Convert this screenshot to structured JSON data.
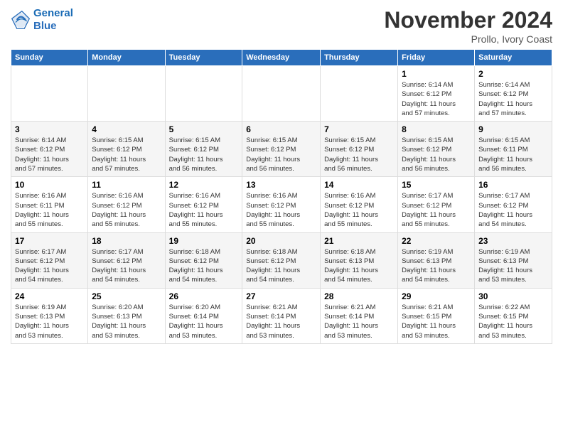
{
  "header": {
    "logo_line1": "General",
    "logo_line2": "Blue",
    "month_title": "November 2024",
    "subtitle": "Prollo, Ivory Coast"
  },
  "days_of_week": [
    "Sunday",
    "Monday",
    "Tuesday",
    "Wednesday",
    "Thursday",
    "Friday",
    "Saturday"
  ],
  "weeks": [
    [
      {
        "day": "",
        "info": ""
      },
      {
        "day": "",
        "info": ""
      },
      {
        "day": "",
        "info": ""
      },
      {
        "day": "",
        "info": ""
      },
      {
        "day": "",
        "info": ""
      },
      {
        "day": "1",
        "info": "Sunrise: 6:14 AM\nSunset: 6:12 PM\nDaylight: 11 hours\nand 57 minutes."
      },
      {
        "day": "2",
        "info": "Sunrise: 6:14 AM\nSunset: 6:12 PM\nDaylight: 11 hours\nand 57 minutes."
      }
    ],
    [
      {
        "day": "3",
        "info": "Sunrise: 6:14 AM\nSunset: 6:12 PM\nDaylight: 11 hours\nand 57 minutes."
      },
      {
        "day": "4",
        "info": "Sunrise: 6:15 AM\nSunset: 6:12 PM\nDaylight: 11 hours\nand 57 minutes."
      },
      {
        "day": "5",
        "info": "Sunrise: 6:15 AM\nSunset: 6:12 PM\nDaylight: 11 hours\nand 56 minutes."
      },
      {
        "day": "6",
        "info": "Sunrise: 6:15 AM\nSunset: 6:12 PM\nDaylight: 11 hours\nand 56 minutes."
      },
      {
        "day": "7",
        "info": "Sunrise: 6:15 AM\nSunset: 6:12 PM\nDaylight: 11 hours\nand 56 minutes."
      },
      {
        "day": "8",
        "info": "Sunrise: 6:15 AM\nSunset: 6:12 PM\nDaylight: 11 hours\nand 56 minutes."
      },
      {
        "day": "9",
        "info": "Sunrise: 6:15 AM\nSunset: 6:11 PM\nDaylight: 11 hours\nand 56 minutes."
      }
    ],
    [
      {
        "day": "10",
        "info": "Sunrise: 6:16 AM\nSunset: 6:11 PM\nDaylight: 11 hours\nand 55 minutes."
      },
      {
        "day": "11",
        "info": "Sunrise: 6:16 AM\nSunset: 6:12 PM\nDaylight: 11 hours\nand 55 minutes."
      },
      {
        "day": "12",
        "info": "Sunrise: 6:16 AM\nSunset: 6:12 PM\nDaylight: 11 hours\nand 55 minutes."
      },
      {
        "day": "13",
        "info": "Sunrise: 6:16 AM\nSunset: 6:12 PM\nDaylight: 11 hours\nand 55 minutes."
      },
      {
        "day": "14",
        "info": "Sunrise: 6:16 AM\nSunset: 6:12 PM\nDaylight: 11 hours\nand 55 minutes."
      },
      {
        "day": "15",
        "info": "Sunrise: 6:17 AM\nSunset: 6:12 PM\nDaylight: 11 hours\nand 55 minutes."
      },
      {
        "day": "16",
        "info": "Sunrise: 6:17 AM\nSunset: 6:12 PM\nDaylight: 11 hours\nand 54 minutes."
      }
    ],
    [
      {
        "day": "17",
        "info": "Sunrise: 6:17 AM\nSunset: 6:12 PM\nDaylight: 11 hours\nand 54 minutes."
      },
      {
        "day": "18",
        "info": "Sunrise: 6:17 AM\nSunset: 6:12 PM\nDaylight: 11 hours\nand 54 minutes."
      },
      {
        "day": "19",
        "info": "Sunrise: 6:18 AM\nSunset: 6:12 PM\nDaylight: 11 hours\nand 54 minutes."
      },
      {
        "day": "20",
        "info": "Sunrise: 6:18 AM\nSunset: 6:12 PM\nDaylight: 11 hours\nand 54 minutes."
      },
      {
        "day": "21",
        "info": "Sunrise: 6:18 AM\nSunset: 6:13 PM\nDaylight: 11 hours\nand 54 minutes."
      },
      {
        "day": "22",
        "info": "Sunrise: 6:19 AM\nSunset: 6:13 PM\nDaylight: 11 hours\nand 54 minutes."
      },
      {
        "day": "23",
        "info": "Sunrise: 6:19 AM\nSunset: 6:13 PM\nDaylight: 11 hours\nand 53 minutes."
      }
    ],
    [
      {
        "day": "24",
        "info": "Sunrise: 6:19 AM\nSunset: 6:13 PM\nDaylight: 11 hours\nand 53 minutes."
      },
      {
        "day": "25",
        "info": "Sunrise: 6:20 AM\nSunset: 6:13 PM\nDaylight: 11 hours\nand 53 minutes."
      },
      {
        "day": "26",
        "info": "Sunrise: 6:20 AM\nSunset: 6:14 PM\nDaylight: 11 hours\nand 53 minutes."
      },
      {
        "day": "27",
        "info": "Sunrise: 6:21 AM\nSunset: 6:14 PM\nDaylight: 11 hours\nand 53 minutes."
      },
      {
        "day": "28",
        "info": "Sunrise: 6:21 AM\nSunset: 6:14 PM\nDaylight: 11 hours\nand 53 minutes."
      },
      {
        "day": "29",
        "info": "Sunrise: 6:21 AM\nSunset: 6:15 PM\nDaylight: 11 hours\nand 53 minutes."
      },
      {
        "day": "30",
        "info": "Sunrise: 6:22 AM\nSunset: 6:15 PM\nDaylight: 11 hours\nand 53 minutes."
      }
    ]
  ]
}
